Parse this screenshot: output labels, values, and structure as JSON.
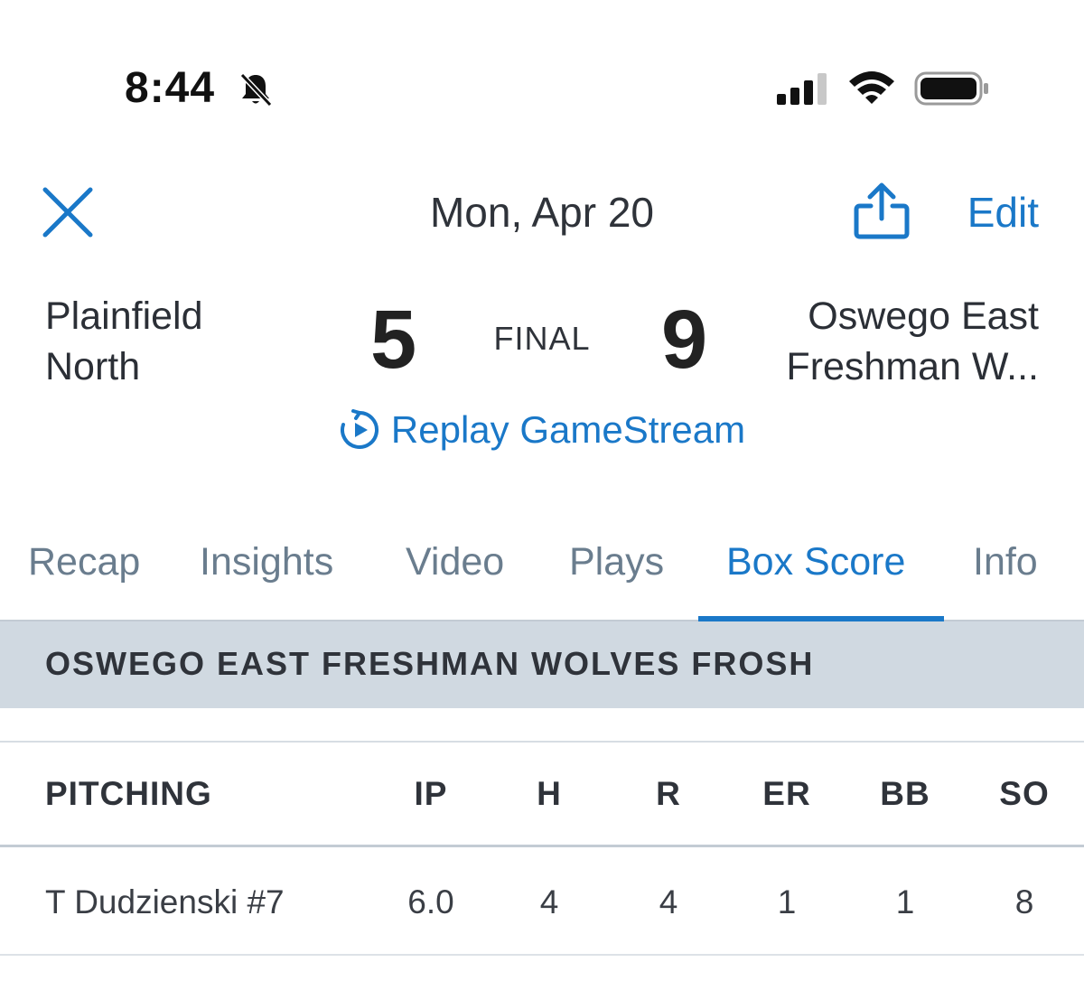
{
  "status_bar": {
    "time": "8:44",
    "icons": [
      "bell-slash-icon",
      "signal-icon",
      "wifi-icon",
      "battery-icon"
    ]
  },
  "header": {
    "close_icon": "close-icon",
    "date": "Mon, Apr 20",
    "share_icon": "share-icon",
    "edit_label": "Edit"
  },
  "game": {
    "home_team": "Plainfield North",
    "home_team_line1": "Plainfield",
    "home_team_line2": "North",
    "home_score": "5",
    "status": "FINAL",
    "away_score": "9",
    "away_team_line1": "Oswego East",
    "away_team_line2": "Freshman W...",
    "replay_label": "Replay GameStream"
  },
  "tabs": [
    {
      "label": "Recap",
      "active": false
    },
    {
      "label": "Insights",
      "active": false
    },
    {
      "label": "Video",
      "active": false
    },
    {
      "label": "Plays",
      "active": false
    },
    {
      "label": "Box Score",
      "active": true
    },
    {
      "label": "Info",
      "active": false
    }
  ],
  "section": {
    "title": "OSWEGO EAST FRESHMAN WOLVES FROSH"
  },
  "pitching_table": {
    "headers": [
      "PITCHING",
      "IP",
      "H",
      "R",
      "ER",
      "BB",
      "SO"
    ],
    "rows": [
      [
        "T Dudzienski #7",
        "6.0",
        "4",
        "4",
        "1",
        "1",
        "8"
      ]
    ]
  },
  "colors": {
    "accent": "#1a78c8",
    "tab_inactive": "#6a7d8e",
    "section_bg": "#d0d9e1",
    "text": "#2b2f36"
  }
}
